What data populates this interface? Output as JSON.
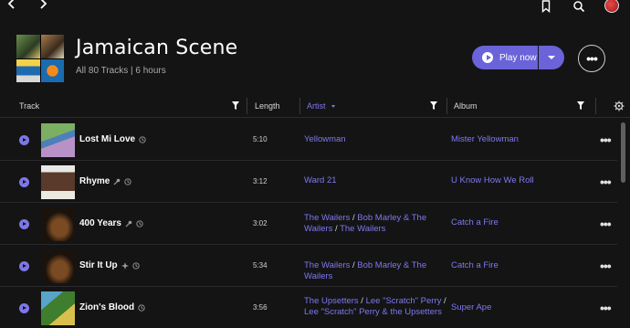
{
  "header": {
    "title": "Jamaican Scene",
    "subtitle": "All 80 Tracks | 6 hours",
    "play_label": "Play now",
    "more_label": "•••"
  },
  "columns": {
    "track": "Track",
    "length": "Length",
    "artist": "Artist",
    "album": "Album"
  },
  "tracks": [
    {
      "title": "Lost Mi Love",
      "length": "5:10",
      "artists": [
        "Yellowman"
      ],
      "album": "Mister Yellowman",
      "icons": [
        "history-icon"
      ]
    },
    {
      "title": "Rhyme",
      "length": "3:12",
      "artists": [
        "Ward 21"
      ],
      "album": "U Know How We Roll",
      "icons": [
        "mic-icon",
        "history-icon"
      ]
    },
    {
      "title": "400 Years",
      "length": "3:02",
      "artists": [
        "The Wailers",
        "Bob Marley & The Wailers",
        "The Wailers"
      ],
      "album": "Catch a Fire",
      "icons": [
        "mic-icon",
        "history-icon"
      ]
    },
    {
      "title": "Stir It Up",
      "length": "5:34",
      "artists": [
        "The Wailers",
        "Bob Marley & The Wailers"
      ],
      "album": "Catch a Fire",
      "icons": [
        "sparkle-icon",
        "history-icon"
      ]
    },
    {
      "title": "Zion's Blood",
      "length": "3:56",
      "artists": [
        "The Upsetters",
        "Lee \"Scratch\" Perry",
        "Lee \"Scratch\" Perry & the Upsetters"
      ],
      "album": "Super Ape",
      "icons": [
        "history-icon"
      ]
    }
  ],
  "colors": {
    "accent": "#6b63d9",
    "link": "#7f78ee",
    "background": "#141415"
  }
}
